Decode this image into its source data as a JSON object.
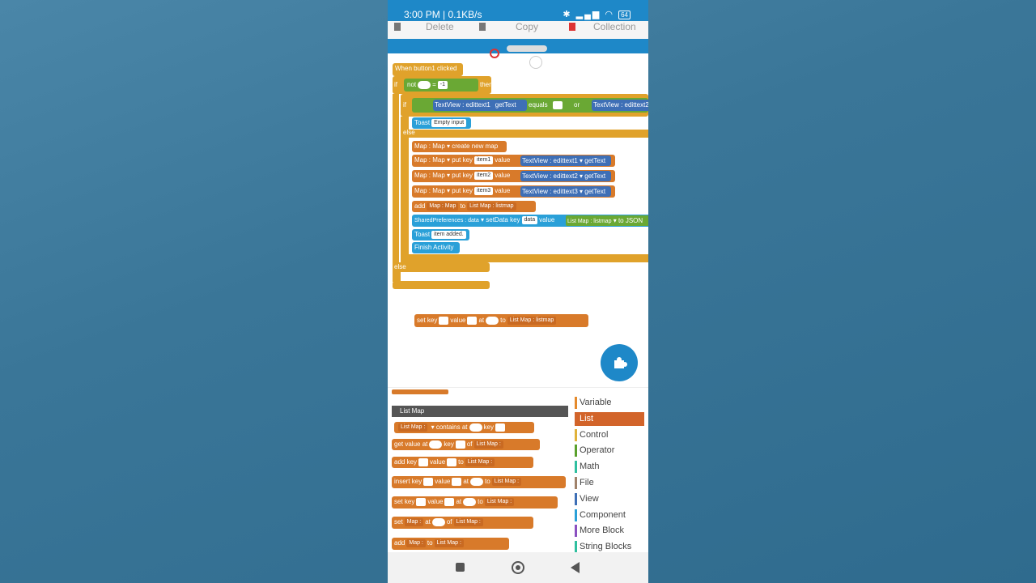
{
  "status": {
    "time": "3:00 PM | 0.1KB/s",
    "battery": "64"
  },
  "context_menu": {
    "delete": "Delete",
    "copy": "Copy",
    "collection": "Collection"
  },
  "blocks": {
    "event": "When button1 clicked",
    "if_kw": "if",
    "not_kw": "not",
    "eq": "=",
    "neg_one": "-1",
    "then_kw": "then",
    "inner_if": "if",
    "tv1": "TextView : edittext1",
    "get_text": "getText",
    "equals": "equals",
    "or_kw": "or",
    "tv2": "TextView : edittext2",
    "toast": "Toast",
    "empty_input": "Empty input",
    "else_kw": "else",
    "map_map": "Map : Map",
    "create_new_map": "create new map",
    "put_key": "put key",
    "value_kw": "value",
    "item1": "item1",
    "item2": "item2",
    "item3": "item3",
    "tv3": "TextView : edittext3",
    "add_kw": "add",
    "to_kw": "to",
    "list_map_listmap": "List Map : listmap",
    "shared_prefs": "SharedPreferences : data",
    "set_data": "setData",
    "key_kw": "key",
    "data_val": "data",
    "to_json": "to JSON",
    "item_added": "item added.",
    "finish_activity": "Finish Activity",
    "outer_else": "else",
    "set_key": "set key",
    "at_kw": "at"
  },
  "palette": {
    "header": "List Map",
    "list_map": "List Map :",
    "contains_at": "contains at",
    "key_kw": "key",
    "get_value_at": "get value at",
    "of_kw": "of",
    "add_key": "add key",
    "value_kw": "value",
    "to_kw": "to",
    "insert_key": "insert key",
    "at_kw": "at",
    "set_key": "set key",
    "set_kw": "set",
    "map_kw": "Map :",
    "add_kw": "add"
  },
  "categories": [
    {
      "label": "Variable",
      "color": "#e58a2c"
    },
    {
      "label": "List",
      "color": "#d2642a"
    },
    {
      "label": "Control",
      "color": "#e0b23a"
    },
    {
      "label": "Operator",
      "color": "#5aa02c"
    },
    {
      "label": "Math",
      "color": "#2fbf9f"
    },
    {
      "label": "File",
      "color": "#a0826a"
    },
    {
      "label": "View",
      "color": "#3e6fb6"
    },
    {
      "label": "Component",
      "color": "#2aa0d8"
    },
    {
      "label": "More Block",
      "color": "#8a4fc0"
    },
    {
      "label": "String Blocks",
      "color": "#2fbf9f"
    }
  ]
}
